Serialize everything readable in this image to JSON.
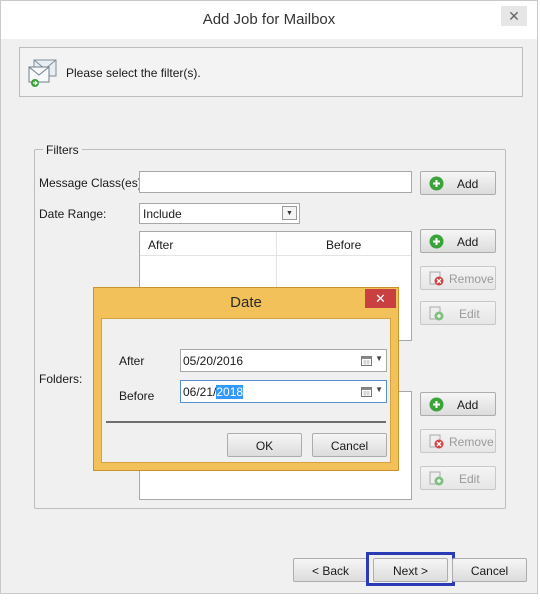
{
  "window": {
    "title": "Add Job for Mailbox",
    "close_glyph": "✕"
  },
  "header": {
    "text": "Please select the filter(s).",
    "icon": "mailbox-icon"
  },
  "filters": {
    "legend": "Filters",
    "message_class_label": "Message Class(es):",
    "message_class_value": "",
    "message_class_add": "Add",
    "date_range_label": "Date Range:",
    "date_range_value": "Include",
    "date_columns": [
      "After",
      "Before"
    ],
    "date_add": "Add",
    "date_remove": "Remove",
    "date_edit": "Edit",
    "folders_label": "Folders:",
    "folders_add": "Add",
    "folders_remove": "Remove",
    "folders_edit": "Edit"
  },
  "nav": {
    "back": "< Back",
    "next": "Next >",
    "cancel": "Cancel"
  },
  "date_dialog": {
    "title": "Date",
    "close_glyph": "✕",
    "after_label": "After",
    "after_value": "05/20/2016",
    "before_label": "Before",
    "before_value_prefix": "06/21/",
    "before_value_selected": "2018",
    "ok": "OK",
    "cancel": "Cancel"
  },
  "colors": {
    "accent": "#2b3bb5",
    "dialog_frame": "#f2c15a",
    "dialog_close": "#c94040",
    "add_icon": "#3aa33a",
    "remove_icon": "#d04545"
  }
}
